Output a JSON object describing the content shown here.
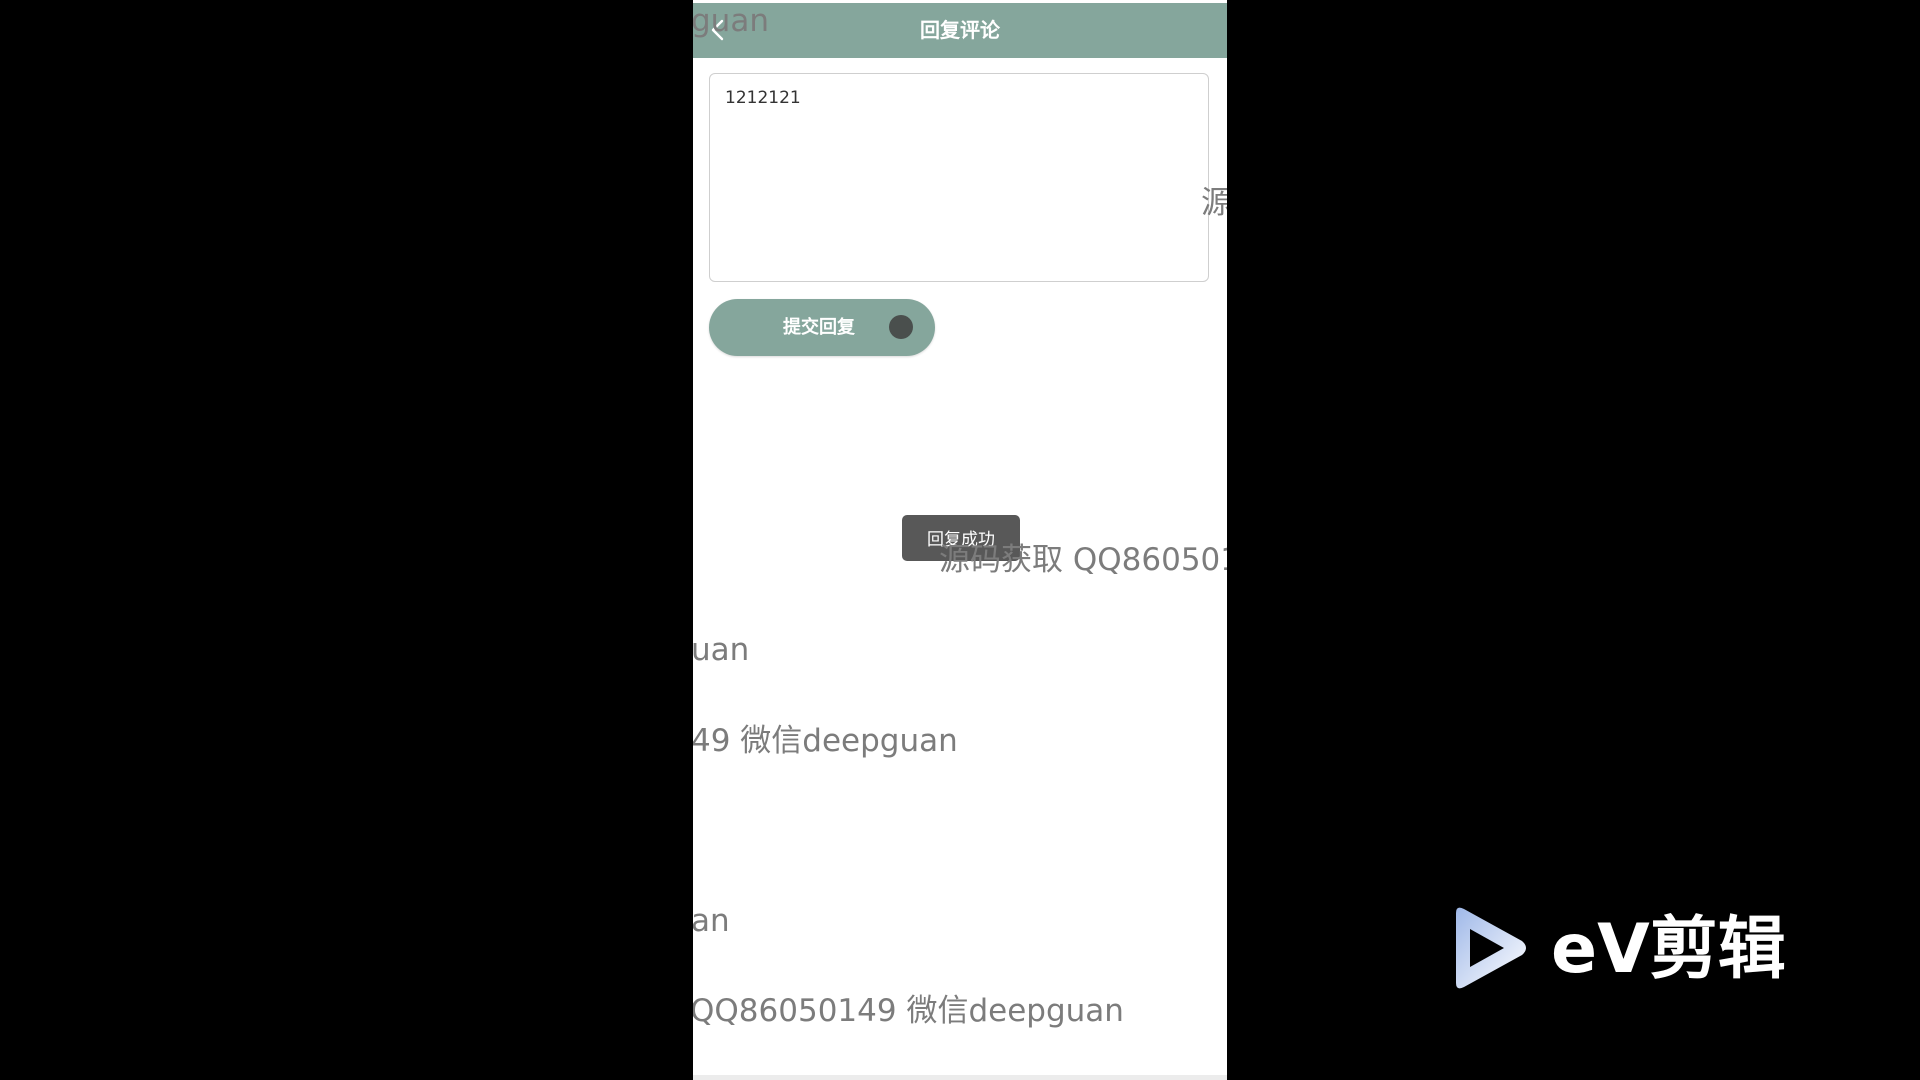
{
  "header": {
    "title": "回复评论",
    "back_icon": "chevron-left-icon"
  },
  "reply": {
    "value": "1212121"
  },
  "submit": {
    "label": "提交回复",
    "loading": true
  },
  "toast": {
    "text": "回复成功"
  },
  "watermarks": [
    "guan",
    "源",
    "源码获取 QQ860501",
    "uan",
    "49 微信deepguan",
    "an",
    "QQ86050149 微信deepguan"
  ],
  "overlay_logo": {
    "text": "eV剪辑",
    "icon": "play-icon"
  },
  "colors": {
    "accent": "#85a69c",
    "toast_bg": "#585858",
    "background": "#000000"
  }
}
